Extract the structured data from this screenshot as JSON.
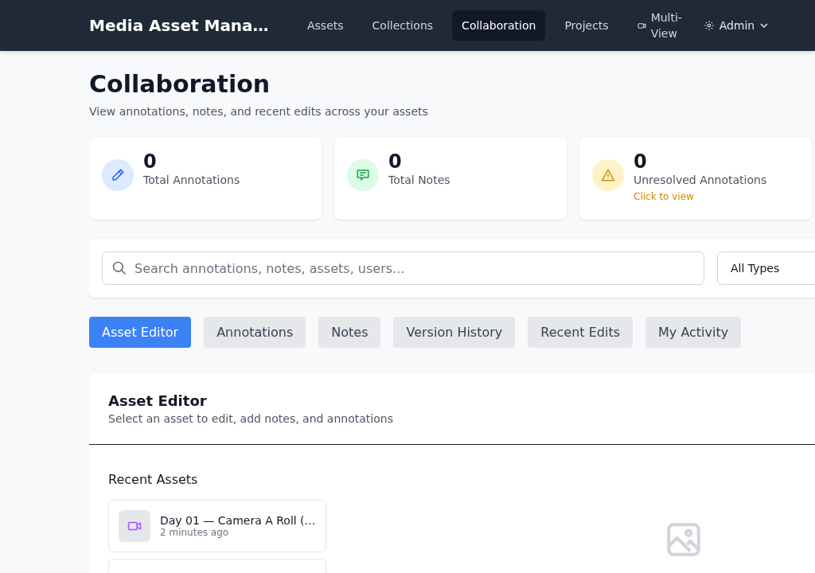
{
  "nav": {
    "title": "Media Asset Mana…",
    "items": [
      {
        "label": "Assets",
        "selected": false,
        "kind": "plain"
      },
      {
        "label": "Collections",
        "selected": false,
        "kind": "plain"
      },
      {
        "label": "Collaboration",
        "selected": true,
        "kind": "plain"
      },
      {
        "label": "Projects",
        "selected": false,
        "kind": "plain"
      },
      {
        "label": "Multi-View",
        "selected": false,
        "kind": "camera"
      }
    ],
    "user": "Admin"
  },
  "page": {
    "title": "Collaboration",
    "subtitle": "View annotations, notes, and recent edits across your assets"
  },
  "stats": [
    {
      "value": "0",
      "label": "Total Annotations",
      "kind": "pencil",
      "color": "#dbeafe"
    },
    {
      "value": "0",
      "label": "Total Notes",
      "kind": "chat",
      "color": "#dcfce7"
    },
    {
      "value": "0",
      "label": "Unresolved Annotations",
      "kind": "warning",
      "color": "#fef3c7",
      "link": "Click to view"
    }
  ],
  "search": {
    "placeholder": "Search annotations, notes, assets, users..."
  },
  "type_filter": {
    "value": "All Types"
  },
  "tabs": [
    {
      "label": "Asset Editor",
      "selected": true
    },
    {
      "label": "Annotations",
      "selected": false
    },
    {
      "label": "Notes",
      "selected": false
    },
    {
      "label": "Version History",
      "selected": false
    },
    {
      "label": "Recent Edits",
      "selected": false
    },
    {
      "label": "My Activity",
      "selected": false
    }
  ],
  "editor": {
    "title": "Asset Editor",
    "subtitle": "Select an asset to edit, add notes, and annotations",
    "recent_heading": "Recent Assets",
    "assets": [
      {
        "name": "Day 01 — Camera A Roll (…",
        "time": "2 minutes ago",
        "kind": "video"
      }
    ]
  }
}
